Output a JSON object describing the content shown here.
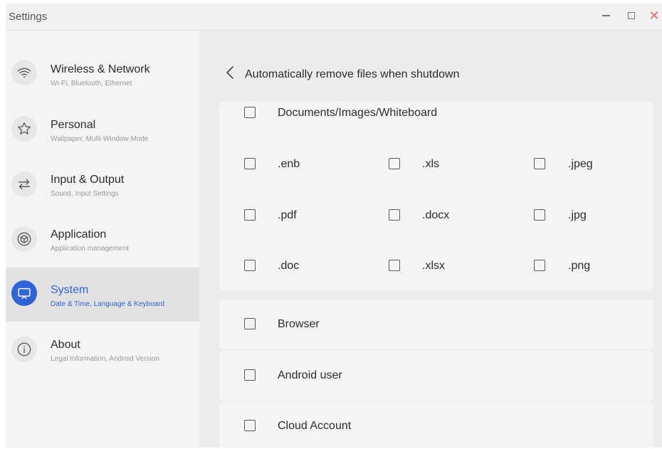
{
  "window": {
    "title": "Settings",
    "controls": {
      "minimize": "minimize",
      "maximize": "maximize",
      "close": "✕"
    }
  },
  "sidebar": {
    "items": [
      {
        "title": "Wireless & Network",
        "subtitle": "Wi-Fi, Bluetooth, Ethernet",
        "icon": "wifi-icon"
      },
      {
        "title": "Personal",
        "subtitle": "Wallpaper, Multi-Window Mode",
        "icon": "star-icon"
      },
      {
        "title": "Input & Output",
        "subtitle": "Sound, Input Settings",
        "icon": "swap-arrows-icon"
      },
      {
        "title": "Application",
        "subtitle": "Application management",
        "icon": "cube-icon"
      },
      {
        "title": "System",
        "subtitle": "Date & Time, Language & Keyboard",
        "icon": "monitor-icon",
        "active": true
      },
      {
        "title": "About",
        "subtitle": "Legal Information, Android Version",
        "icon": "info-icon"
      }
    ]
  },
  "main": {
    "title": "Automatically remove files when shutdown",
    "group": {
      "label": "Documents/Images/Whiteboard",
      "checked": false,
      "options": [
        [
          ".enb",
          ".xls",
          ".jpeg"
        ],
        [
          ".pdf",
          ".docx",
          ".jpg"
        ],
        [
          ".doc",
          ".xlsx",
          ".png"
        ]
      ]
    },
    "rows": [
      {
        "label": "Browser",
        "checked": false
      },
      {
        "label": "Android user",
        "checked": false
      },
      {
        "label": "Cloud Account",
        "checked": false
      }
    ]
  },
  "colors": {
    "accent": "#2f63d8",
    "close": "#e46a6a",
    "background": "#eeeeee",
    "card": "#f4f4f4"
  }
}
